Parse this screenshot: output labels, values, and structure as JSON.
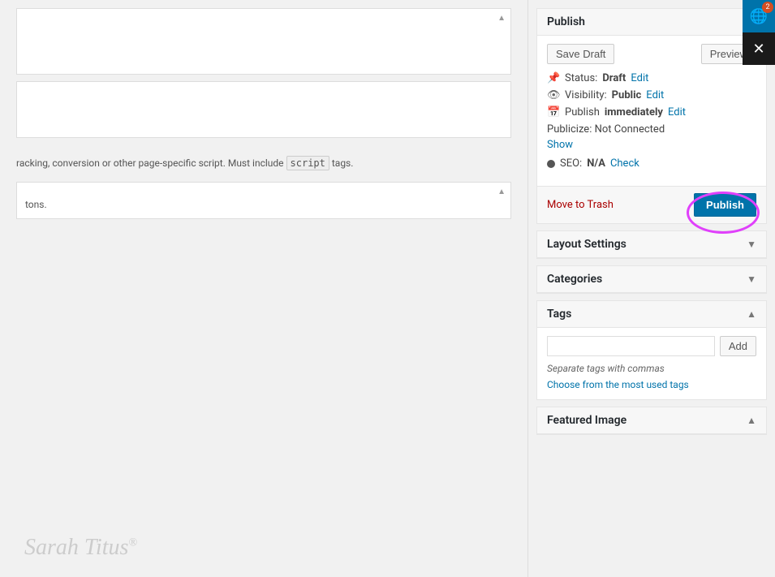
{
  "sidebar": {
    "publish": {
      "title": "Publish",
      "save_draft_label": "Save Draft",
      "preview_label": "Preview",
      "status_label": "Status:",
      "status_value": "Draft",
      "status_edit": "Edit",
      "visibility_label": "Visibility:",
      "visibility_value": "Public",
      "visibility_edit": "Edit",
      "publish_label": "Publish",
      "publish_time": "immediately",
      "publish_edit": "Edit",
      "publicize_label": "Publicize: Not Connected",
      "publicize_show": "Show",
      "seo_label": "SEO:",
      "seo_value": "N/A",
      "seo_check": "Check",
      "move_to_trash": "Move to Trash",
      "publish_button": "Publish"
    },
    "layout_settings": {
      "title": "Layout Settings",
      "arrow": "▼"
    },
    "categories": {
      "title": "Categories",
      "arrow": "▼"
    },
    "tags": {
      "title": "Tags",
      "arrow": "▲",
      "add_label": "Add",
      "placeholder": "",
      "hint": "Separate tags with commas",
      "choose_link": "Choose from the most used tags"
    },
    "featured_image": {
      "title": "Featured Image",
      "arrow": "▲"
    }
  },
  "main": {
    "script_hint_prefix": "racking, conversion or other page-specific script. Must include",
    "script_tag": "script",
    "script_hint_suffix": "tags.",
    "block2_text": "tons.",
    "watermark": "Sarah Titus"
  },
  "icons": {
    "globe": "🌐",
    "close": "✕",
    "badge_count": "2",
    "pin": "📌",
    "eye": "👁",
    "calendar": "📅"
  }
}
